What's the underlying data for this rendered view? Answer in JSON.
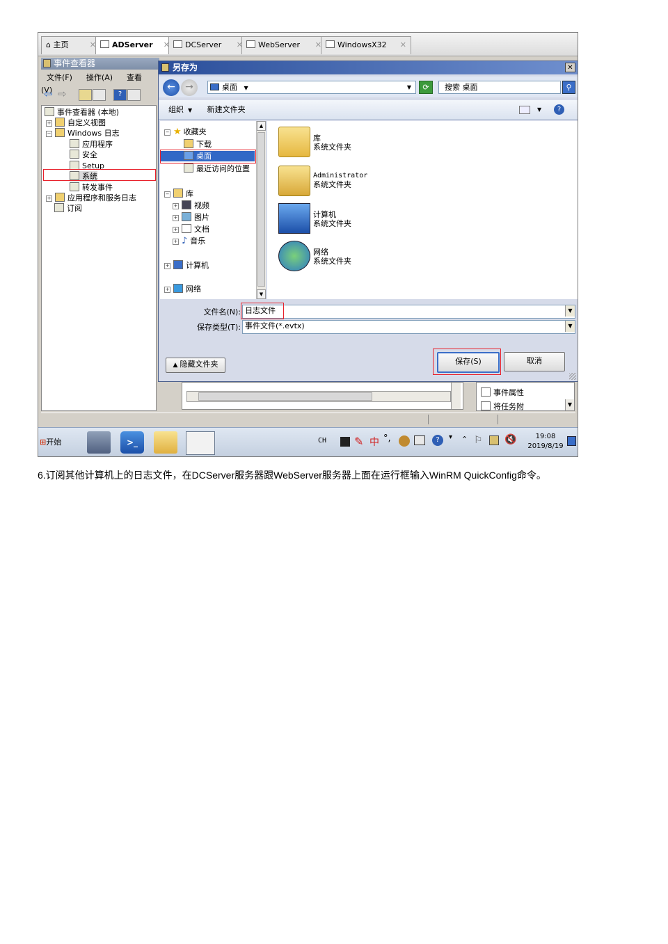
{
  "tabs": [
    {
      "label": "主页"
    },
    {
      "label": "ADServer"
    },
    {
      "label": "DCServer"
    },
    {
      "label": "WebServer"
    },
    {
      "label": "WindowsX32"
    }
  ],
  "event_viewer": {
    "title": "事件查看器",
    "menu": [
      "文件(F)",
      "操作(A)",
      "查看(V)"
    ],
    "tree": {
      "root": "事件查看器 (本地)",
      "custom_views": "自定义视图",
      "windows_logs": "Windows 日志",
      "logs": [
        "应用程序",
        "安全",
        "Setup",
        "系统",
        "转发事件"
      ],
      "app_service_logs": "应用程序和服务日志",
      "subscriptions": "订阅"
    }
  },
  "dialog": {
    "title": "另存为",
    "close": "✕",
    "address": "桌面",
    "search_placeholder": "搜索 桌面",
    "organize": "组织",
    "new_folder": "新建文件夹",
    "nav": {
      "favorites": "收藏夹",
      "fav_items": [
        "下载",
        "桌面",
        "最近访问的位置"
      ],
      "libraries": "库",
      "lib_items": [
        "视频",
        "图片",
        "文档",
        "音乐"
      ],
      "computer": "计算机",
      "network": "网络"
    },
    "items": [
      {
        "name": "库",
        "type": "系统文件夹"
      },
      {
        "name": "Administrator",
        "type": "系统文件夹"
      },
      {
        "name": "计算机",
        "type": "系统文件夹"
      },
      {
        "name": "网络",
        "type": "系统文件夹"
      }
    ],
    "filename_label": "文件名(N):",
    "filename_value": "日志文件",
    "filetype_label": "保存类型(T):",
    "filetype_value": "事件文件(*.evtx)",
    "hide_folders": "隐藏文件夹",
    "save": "保存(S)",
    "cancel": "取消"
  },
  "actions": [
    "事件属性",
    "将任务附"
  ],
  "taskbar": {
    "start": "开始",
    "lang": "CH",
    "ime": "中",
    "time": "19:08",
    "date": "2019/8/19"
  },
  "caption": "6.订阅其他计算机上的日志文件，在DCServer服务器跟WebServer服务器上面在运行框输入WinRM QuickConfig命令。",
  "colors": {
    "highlight": "#e8202a",
    "title_blue": "#2a4e9a",
    "selection": "#3168c6"
  }
}
